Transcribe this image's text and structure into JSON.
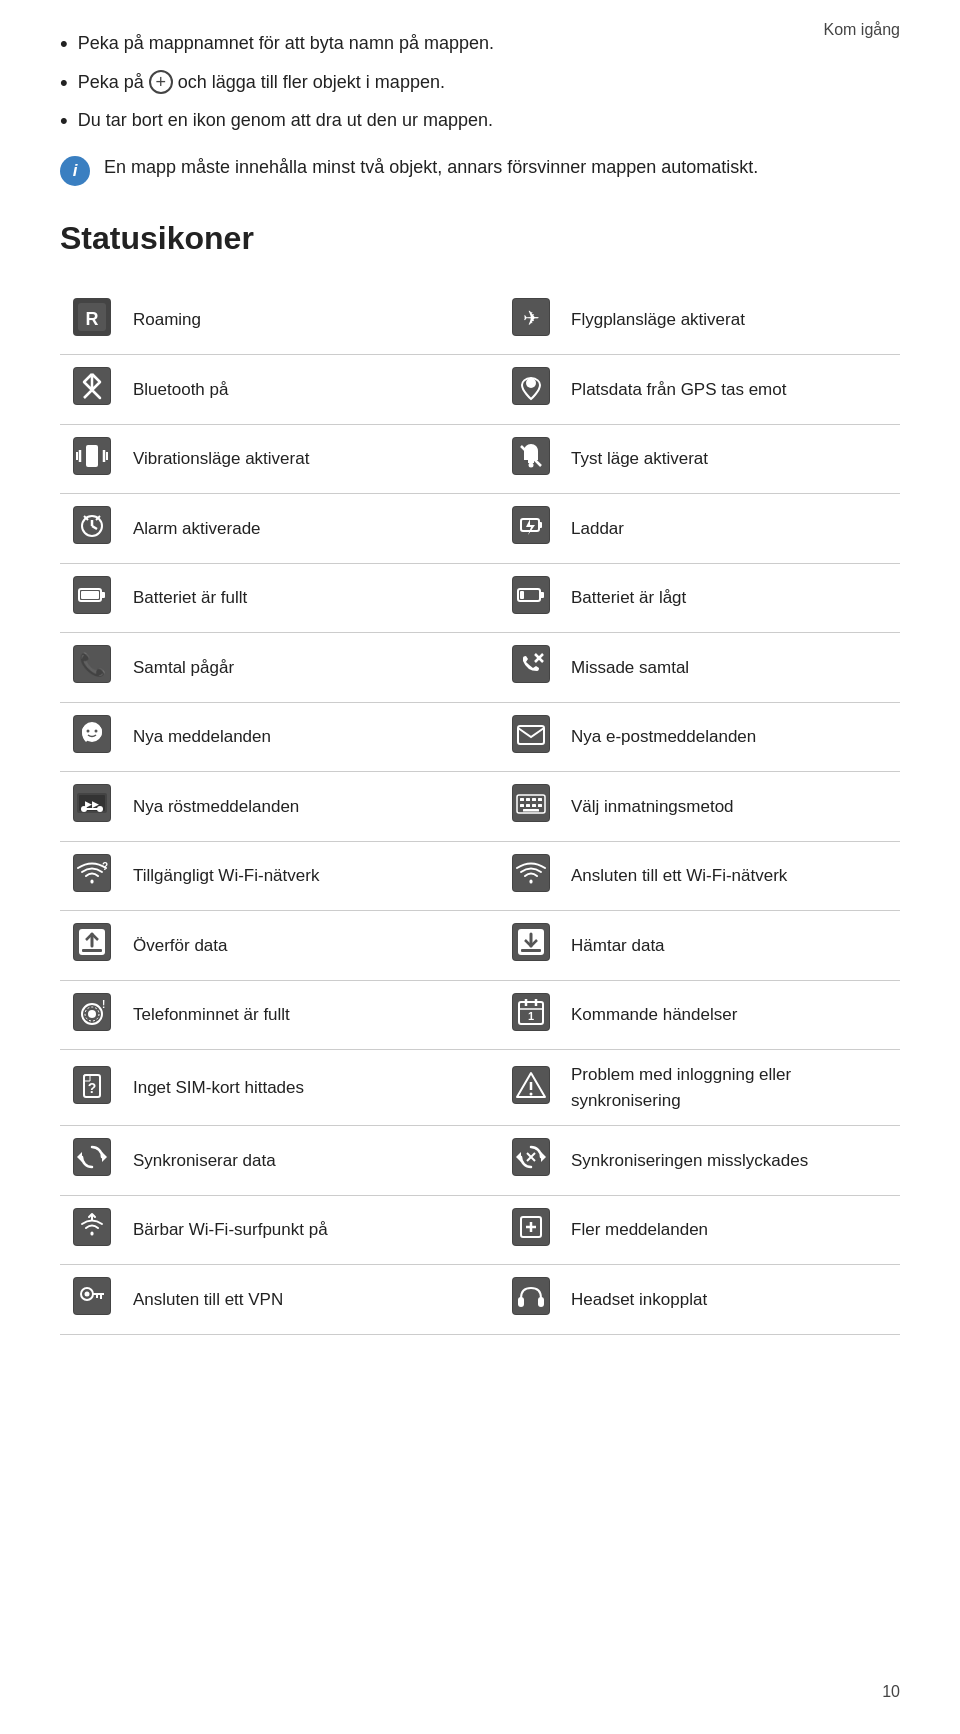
{
  "header": {
    "top_label": "Kom igång"
  },
  "intro": {
    "items": [
      {
        "type": "bullet",
        "text": "Peka på mappnamnet för att byta namn på mappen."
      },
      {
        "type": "plus",
        "text": "Peka på   och lägga till fler objekt i mappen."
      },
      {
        "type": "bullet",
        "text": "Du tar bort en ikon genom att dra ut den ur mappen."
      }
    ],
    "info_text": "En mapp måste innehålla minst två objekt, annars försvinner mappen automatiskt."
  },
  "section": {
    "title": "Statusikoner"
  },
  "rows": [
    {
      "left_icon": "R",
      "left_label": "Roaming",
      "right_icon": "✈",
      "right_label": "Flygplansläge aktiverat"
    },
    {
      "left_icon": "B",
      "left_label": "Bluetooth på",
      "right_icon": "GPS",
      "right_label": "Platsdata från GPS tas emot"
    },
    {
      "left_icon": "V",
      "left_label": "Vibrationsläge aktiverat",
      "right_icon": "🔇",
      "right_label": "Tyst läge aktiverat"
    },
    {
      "left_icon": "⏰",
      "left_label": "Alarm aktiverade",
      "right_icon": "⚡",
      "right_label": "Laddar"
    },
    {
      "left_icon": "🔋",
      "left_label": "Batteriet är fullt",
      "right_icon": "🔋!",
      "right_label": "Batteriet är lågt"
    },
    {
      "left_icon": "📞",
      "left_label": "Samtal pågår",
      "right_icon": "✗📞",
      "right_label": "Missade samtal"
    },
    {
      "left_icon": "💬",
      "left_label": "Nya meddelanden",
      "right_icon": "✉",
      "right_label": "Nya e-postmeddelanden"
    },
    {
      "left_icon": "📻",
      "left_label": "Nya röstmeddelanden",
      "right_icon": "⌨",
      "right_label": "Välj inmatningsmetod"
    },
    {
      "left_icon": "WiFi?",
      "left_label": "Tillgängligt Wi-Fi-nätverk",
      "right_icon": "WiFi✓",
      "right_label": "Ansluten till ett Wi-Fi-nätverk"
    },
    {
      "left_icon": "↑",
      "left_label": "Överför data",
      "right_icon": "↓",
      "right_label": "Hämtar data"
    },
    {
      "left_icon": "💿!",
      "left_label": "Telefonminnet är fullt",
      "right_icon": "1",
      "right_label": "Kommande händelser"
    },
    {
      "left_icon": "?",
      "left_label": "Inget SIM-kort hittades",
      "right_icon": "⚠",
      "right_label": "Problem med inloggning eller synkronisering"
    },
    {
      "left_icon": "↻",
      "left_label": "Synkroniserar data",
      "right_icon": "✗↻",
      "right_label": "Synkroniseringen misslyckades"
    },
    {
      "left_icon": "WiFi↑",
      "left_label": "Bärbar Wi-Fi-surfpunkt på",
      "right_icon": "+",
      "right_label": "Fler meddelanden"
    },
    {
      "left_icon": "VPN",
      "left_label": "Ansluten till ett VPN",
      "right_icon": "🎧",
      "right_label": "Headset inkopplat"
    }
  ],
  "footer": {
    "page_number": "10"
  }
}
